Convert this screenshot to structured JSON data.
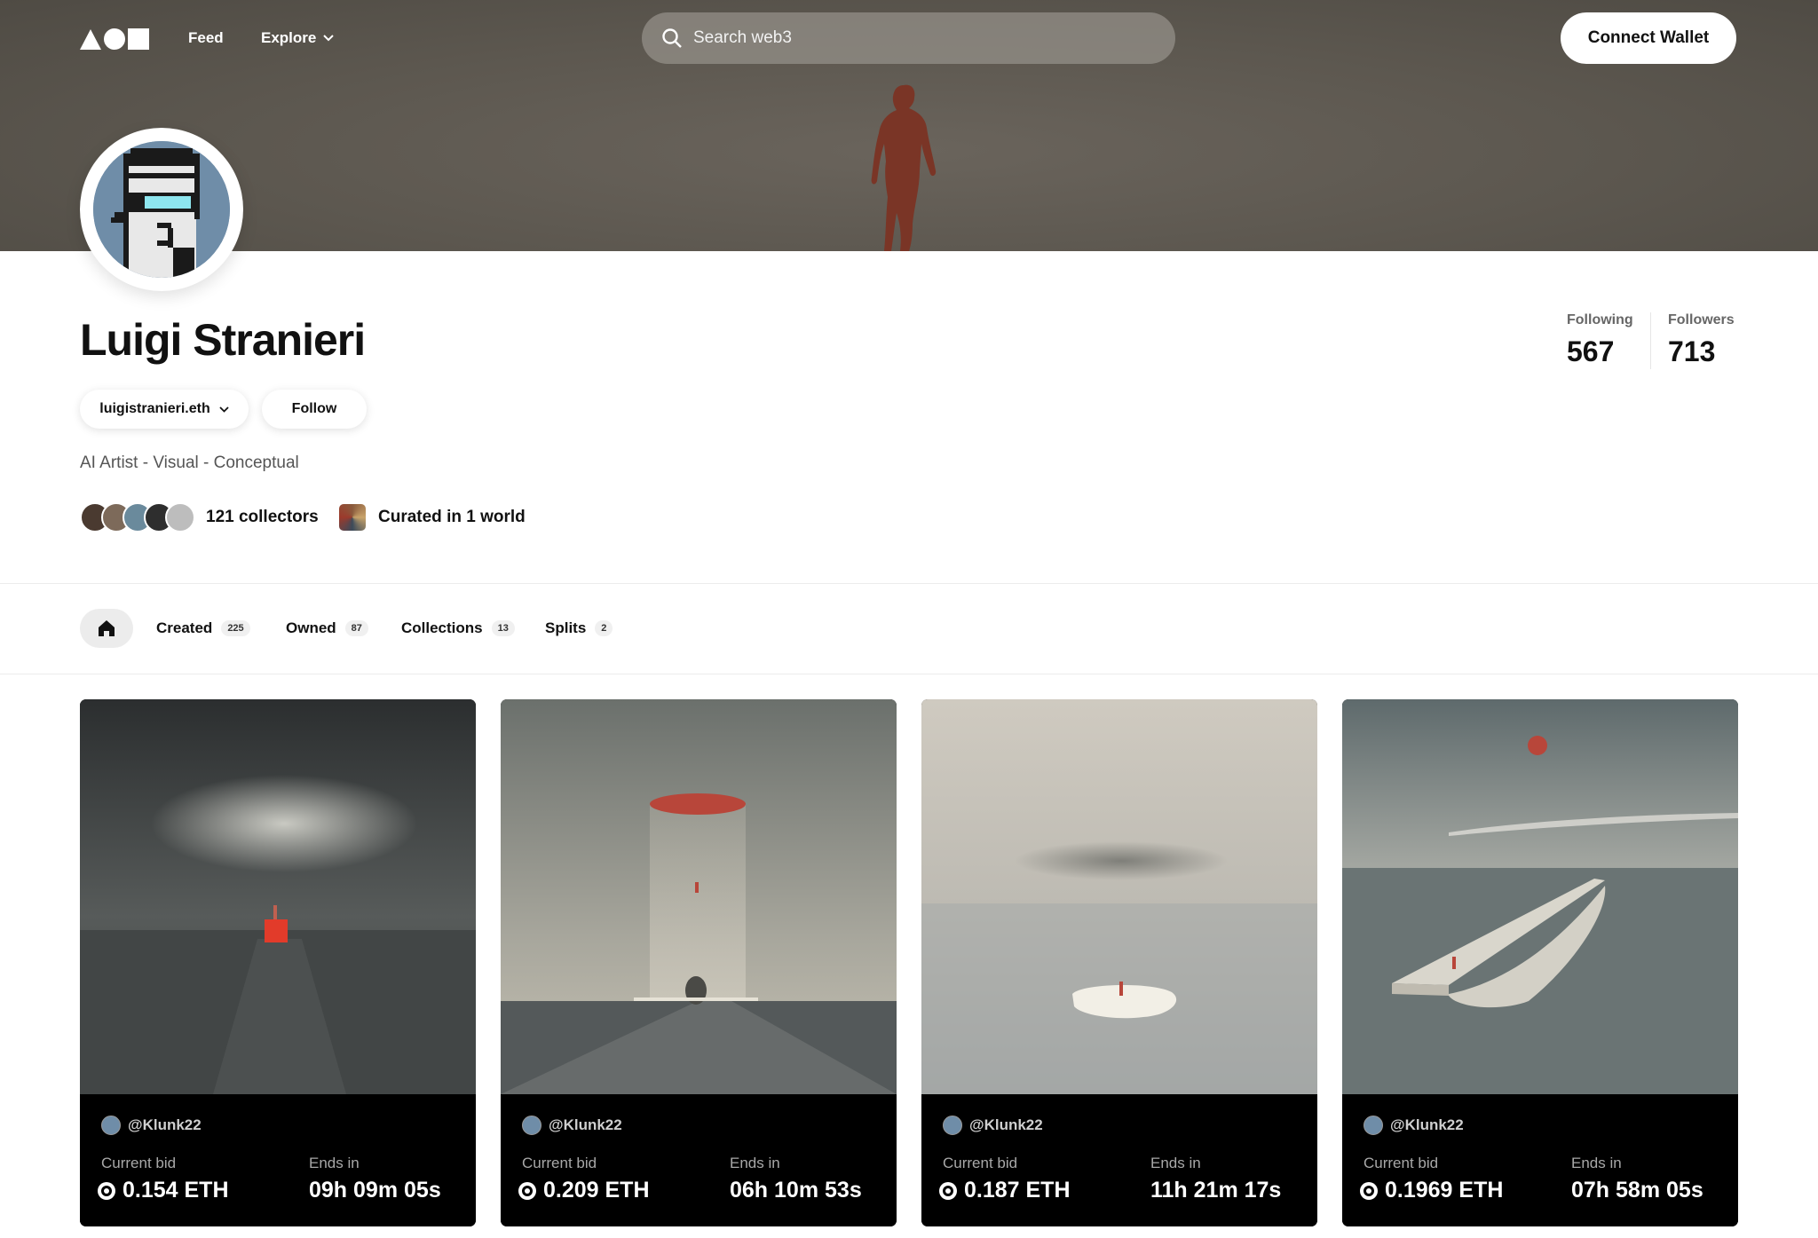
{
  "nav": {
    "logo_icon": "aoi-logo",
    "feed_label": "Feed",
    "explore_label": "Explore",
    "search_placeholder": "Search web3",
    "connect_label": "Connect Wallet"
  },
  "profile": {
    "name": "Luigi Stranieri",
    "ens": "luigistranieri.eth",
    "follow_label": "Follow",
    "bio": "AI Artist - Visual - Conceptual",
    "collectors_label": "121 collectors",
    "curated_label": "Curated in 1 world",
    "following_label": "Following",
    "following_value": "567",
    "followers_label": "Followers",
    "followers_value": "713"
  },
  "tabs": [
    {
      "label": "Created",
      "count": "225"
    },
    {
      "label": "Owned",
      "count": "87"
    },
    {
      "label": "Collections",
      "count": "13"
    },
    {
      "label": "Splits",
      "count": "2"
    }
  ],
  "cards": [
    {
      "creator": "@Klunk22",
      "bid_label": "Current bid",
      "bid": "0.154 ETH",
      "ends_label": "Ends in",
      "ends": "09h 09m 05s"
    },
    {
      "creator": "@Klunk22",
      "bid_label": "Current bid",
      "bid": "0.209 ETH",
      "ends_label": "Ends in",
      "ends": "06h 10m 53s"
    },
    {
      "creator": "@Klunk22",
      "bid_label": "Current bid",
      "bid": "0.187 ETH",
      "ends_label": "Ends in",
      "ends": "11h 21m 17s"
    },
    {
      "creator": "@Klunk22",
      "bid_label": "Current bid",
      "bid": "0.1969 ETH",
      "ends_label": "Ends in",
      "ends": "07h 58m 05s"
    }
  ],
  "colors": {
    "accent_red": "#d93a2b",
    "card_bg": "#000000",
    "avatar_bg": "#6f8da8"
  }
}
